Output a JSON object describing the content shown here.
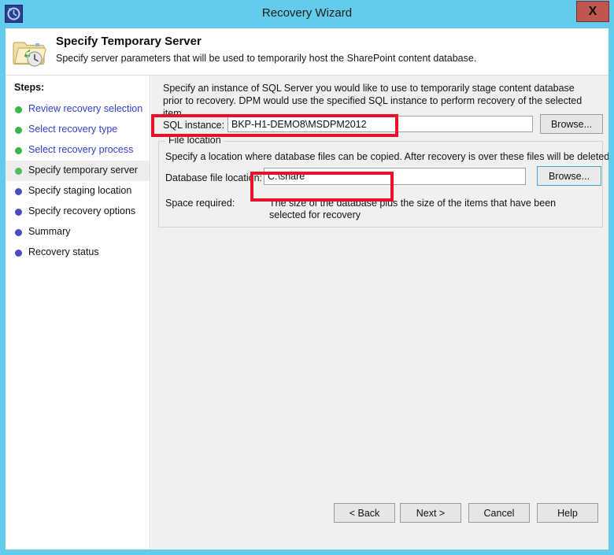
{
  "window": {
    "title": "Recovery Wizard",
    "app_icon": "recovery-clock-icon",
    "close_label": "X"
  },
  "header": {
    "icon": "folder-restore-icon",
    "title": "Specify Temporary Server",
    "subtitle": "Specify server parameters that will be used to temporarily host the SharePoint content database."
  },
  "sidebar": {
    "label": "Steps:",
    "items": [
      {
        "label": "Review recovery selection",
        "state": "done",
        "bullet_color": "#3bb54a"
      },
      {
        "label": "Select recovery type",
        "state": "done",
        "bullet_color": "#3bb54a"
      },
      {
        "label": "Select recovery process",
        "state": "done",
        "bullet_color": "#3bb54a"
      },
      {
        "label": "Specify temporary server",
        "state": "current",
        "bullet_color": "#3bb54a"
      },
      {
        "label": "Specify staging location",
        "state": "pending",
        "bullet_color": "#4b4bbf"
      },
      {
        "label": "Specify recovery options",
        "state": "pending",
        "bullet_color": "#4b4bbf"
      },
      {
        "label": "Summary",
        "state": "pending",
        "bullet_color": "#4b4bbf"
      },
      {
        "label": "Recovery status",
        "state": "pending",
        "bullet_color": "#4b4bbf"
      }
    ]
  },
  "content": {
    "intro": "Specify an instance of SQL Server you would like to use to temporarily stage content database prior to recovery. DPM would use the specified SQL instance to perform recovery of the selected item.",
    "sql_instance": {
      "label": "SQL instance:",
      "value": "BKP-H1-DEMO8\\MSDPM2012",
      "placeholder": "",
      "browse_label": "Browse..."
    },
    "file_location": {
      "legend": "File location",
      "description": "Specify a location where database files can be copied. After recovery is over these files will be deleted.",
      "db_file_location": {
        "label": "Database file location:",
        "value": "C:\\share",
        "placeholder": "",
        "browse_label": "Browse..."
      },
      "space_required": {
        "label": "Space required:",
        "value": "The size of the database plus the size of the items that have been selected for recovery"
      }
    }
  },
  "annotations": {
    "highlight_color": "#e8102a",
    "boxes": [
      {
        "name": "sql-instance-highlight"
      },
      {
        "name": "database-file-location-highlight"
      }
    ]
  },
  "footer": {
    "back_label": "< Back",
    "next_label": "Next >",
    "cancel_label": "Cancel",
    "help_label": "Help"
  }
}
